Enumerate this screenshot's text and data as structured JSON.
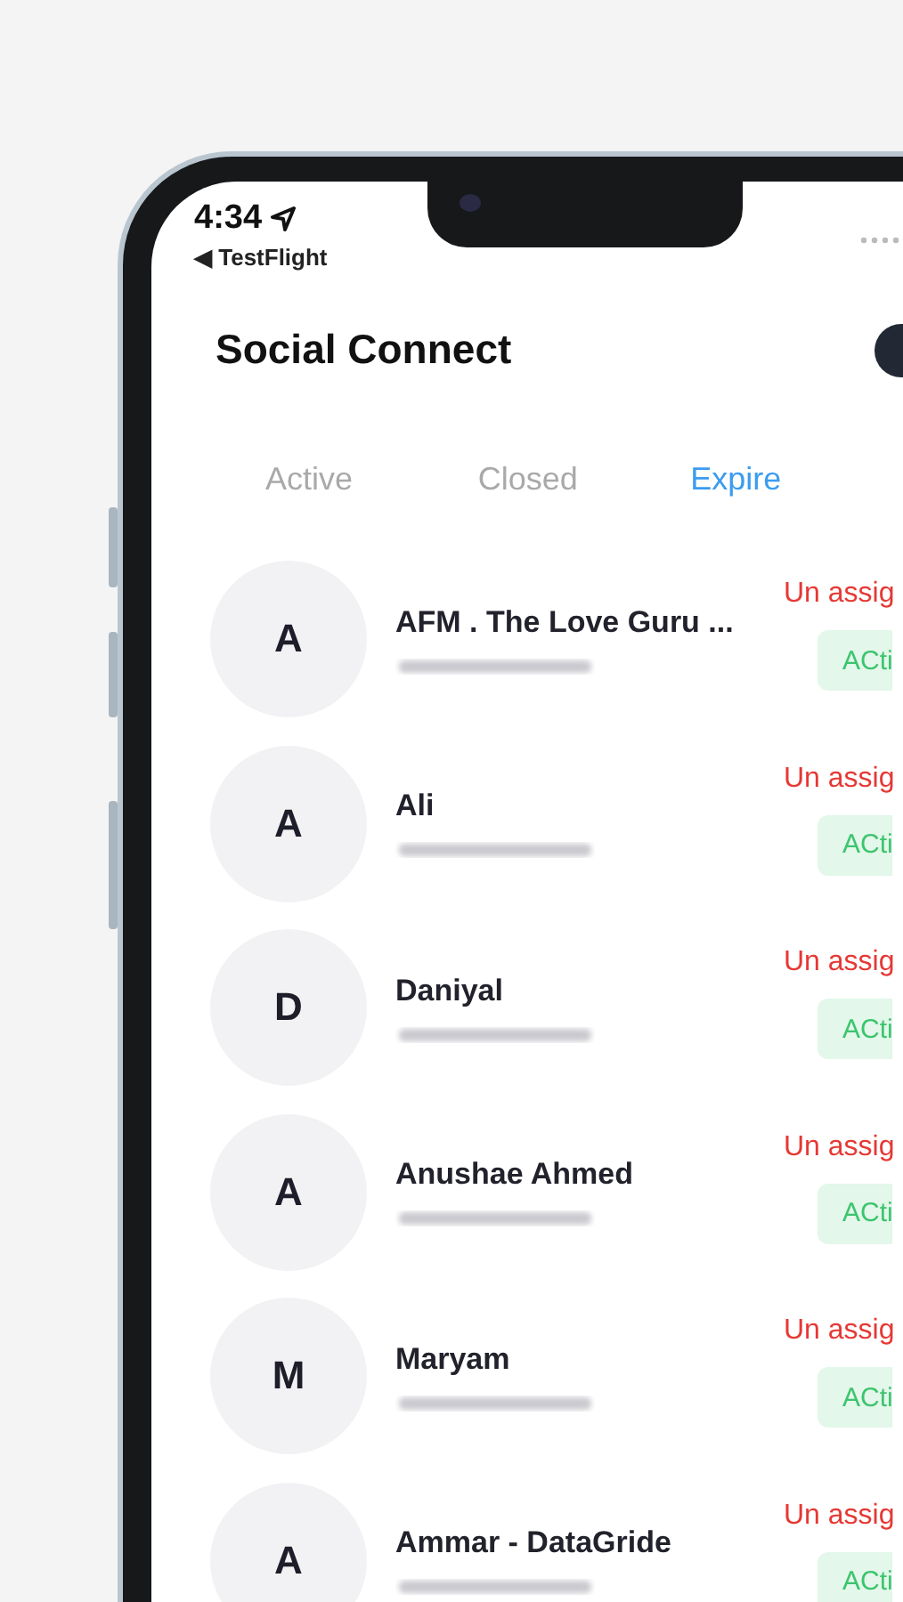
{
  "status_bar": {
    "time": "4:34",
    "back_app": "◀ TestFlight"
  },
  "header": {
    "title": "Social Connect"
  },
  "tabs": [
    {
      "label": "Active",
      "selected": false
    },
    {
      "label": "Closed",
      "selected": false
    },
    {
      "label": "Expire",
      "selected": true
    }
  ],
  "contacts": [
    {
      "initial": "A",
      "name": "AFM . The Love Guru ...",
      "assignment": "Un assig",
      "badge": "ACti"
    },
    {
      "initial": "A",
      "name": "Ali",
      "assignment": "Un assig",
      "badge": "ACti"
    },
    {
      "initial": "D",
      "name": "Daniyal",
      "assignment": "Un assig",
      "badge": "ACti"
    },
    {
      "initial": "A",
      "name": "Anushae Ahmed",
      "assignment": "Un assig",
      "badge": "ACti"
    },
    {
      "initial": "M",
      "name": "Maryam",
      "assignment": "Un assig",
      "badge": "ACti"
    },
    {
      "initial": "A",
      "name": "Ammar - DataGride",
      "assignment": "Un assig",
      "badge": "ACti"
    }
  ]
}
